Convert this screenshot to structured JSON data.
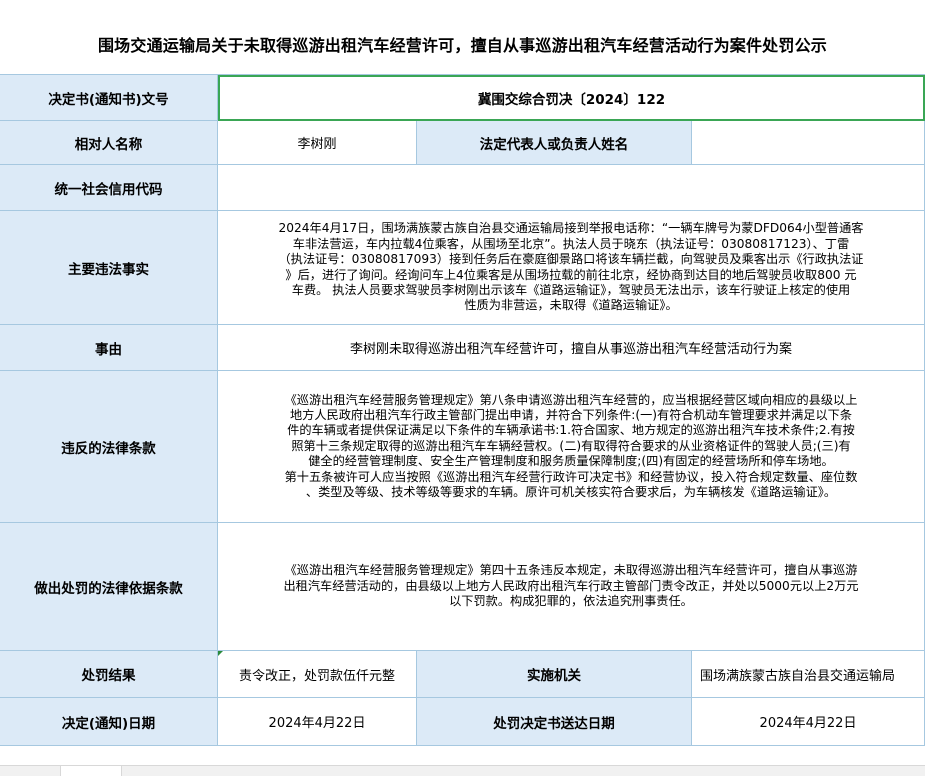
{
  "title": "围场交通运输局关于未取得巡游出租汽车经营许可，擅自从事巡游出租汽车经营活动行为案件处罚公示",
  "rows": {
    "decision_no": {
      "label": "决定书(通知书)文号",
      "value": "冀围交综合罚决〔2024〕122"
    },
    "party": {
      "label": "相对人名称",
      "value": "李树刚",
      "legal_rep_label": "法定代表人或负责人姓名",
      "legal_rep_value": ""
    },
    "credit_code": {
      "label": "统一社会信用代码",
      "value": ""
    },
    "facts": {
      "label": "主要违法事实",
      "lines": [
        "2024年4月17日，围场满族蒙古族自治县交通运输局接到举报电话称：“一辆车牌号为蒙DFD064小型普通客",
        "车非法营运，车内拉载4位乘客，从围场至北京”。执法人员于晓东（执法证号：03080817123）、丁雷",
        "（执法证号：03080817093）接到任务后在豪庭御景路口将该车辆拦截，向驾驶员及乘客出示《行政执法证",
        "》后，进行了询问。经询问车上4位乘客是从围场拉载的前往北京，经协商到达目的地后驾驶员收取800 元",
        "车费。 执法人员要求驾驶员李树刚出示该车《道路运输证》，驾驶员无法出示，该车行驶证上核定的使用",
        "性质为非营运，未取得《道路运输证》。"
      ]
    },
    "cause": {
      "label": "事由",
      "value": "李树刚未取得巡游出租汽车经营许可，擅自从事巡游出租汽车经营活动行为案"
    },
    "violated_law": {
      "label": "违反的法律条款",
      "lines": [
        "《巡游出租汽车经营服务管理规定》第八条申请巡游出租汽车经营的，应当根据经营区域向相应的县级以上",
        "地方人民政府出租汽车行政主管部门提出申请，并符合下列条件:(一)有符合机动车管理要求并满足以下条",
        "件的车辆或者提供保证满足以下条件的车辆承诺书:1.符合国家、地方规定的巡游出租汽车技术条件;2.有按",
        "照第十三条规定取得的巡游出租汽车车辆经营权。(二)有取得符合要求的从业资格证件的驾驶人员;(三)有",
        "健全的经营管理制度、安全生产管理制度和服务质量保障制度;(四)有固定的经营场所和停车场地。",
        "第十五条被许可人应当按照《巡游出租汽车经营行政许可决定书》和经营协议，投入符合规定数量、座位数",
        "、类型及等级、技术等级等要求的车辆。原许可机关核实符合要求后，为车辆核发《道路运输证》。"
      ]
    },
    "penalty_basis": {
      "label": "做出处罚的法律依据条款",
      "lines": [
        "《巡游出租汽车经营服务管理规定》第四十五条违反本规定，未取得巡游出租汽车经营许可，擅自从事巡游",
        "出租汽车经营活动的，由县级以上地方人民政府出租汽车行政主管部门责令改正，并处以5000元以上2万元",
        "以下罚款。构成犯罪的，依法追究刑事责任。"
      ]
    },
    "result": {
      "label": "处罚结果",
      "value": "责令改正，处罚款伍仟元整",
      "authority_label": "实施机关",
      "authority_value": "围场满族蒙古族自治县交通运输局"
    },
    "dates": {
      "label": "决定(通知)日期",
      "value": "2024年4月22日",
      "delivery_label": "处罚决定书送达日期",
      "delivery_value": "2024年4月22日"
    }
  },
  "colors": {
    "label_bg": "#dceaf7",
    "border": "#a6c8e0",
    "selection": "#3aa655"
  }
}
